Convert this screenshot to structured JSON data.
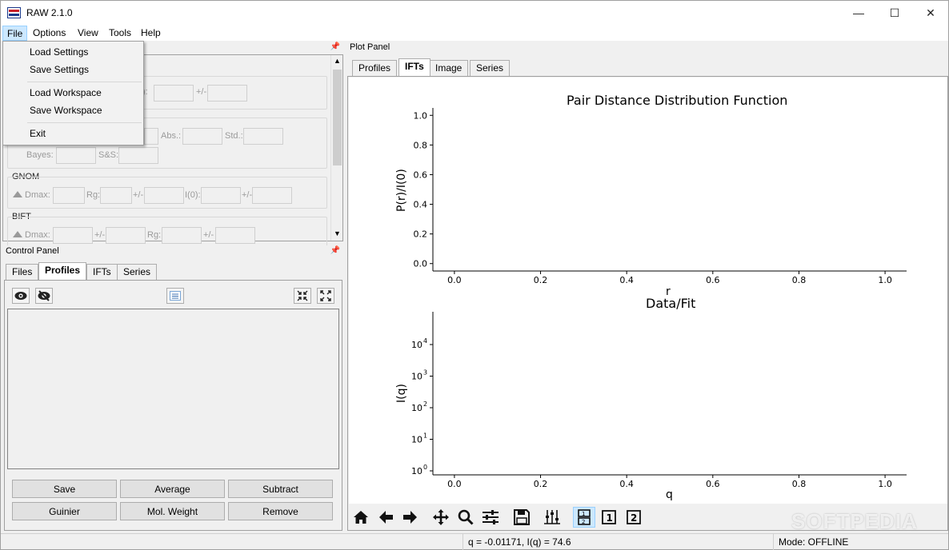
{
  "window": {
    "title": "RAW 2.1.0",
    "controls": {
      "minimize": "—",
      "maximize": "☐",
      "close": "✕"
    }
  },
  "menubar": [
    "File",
    "Options",
    "View",
    "Tools",
    "Help"
  ],
  "file_menu": {
    "items": [
      "Load Settings",
      "Save Settings",
      "Load Workspace",
      "Save Workspace",
      "Exit"
    ]
  },
  "info_panel": {
    "fields_row1": {
      "pm": "+/-"
    },
    "fields_row2": {
      "abs": "Abs.:",
      "std": "Std.:"
    },
    "fields_row3": {
      "bayes": "Bayes:",
      "ss": "S&S:"
    },
    "gnom": {
      "title": "GNOM",
      "dmax": "Dmax:",
      "rg": "Rg:",
      "pm1": "+/-",
      "i0": "I(0):",
      "pm2": "+/-"
    },
    "bift": {
      "title": "BIFT",
      "dmax": "Dmax:",
      "pm1": "+/-",
      "rg": "Rg:",
      "pm2": "+/-"
    }
  },
  "control_panel": {
    "title": "Control Panel",
    "tabs": [
      "Files",
      "Profiles",
      "IFTs",
      "Series"
    ],
    "active_tab": "Profiles",
    "buttons": [
      "Save",
      "Average",
      "Subtract",
      "Guinier",
      "Mol. Weight",
      "Remove"
    ]
  },
  "plot_panel": {
    "title": "Plot Panel",
    "tabs": [
      "Profiles",
      "IFTs",
      "Image",
      "Series"
    ],
    "active_tab": "IFTs"
  },
  "chart_data": [
    {
      "type": "line",
      "title": "Pair Distance Distribution Function",
      "xlabel": "r",
      "ylabel": "P(r)/I(0)",
      "xlim": [
        -0.05,
        1.05
      ],
      "ylim": [
        -0.05,
        1.05
      ],
      "xticks": [
        "0.0",
        "0.2",
        "0.4",
        "0.6",
        "0.8",
        "1.0"
      ],
      "yticks": [
        "0.0",
        "0.2",
        "0.4",
        "0.6",
        "0.8",
        "1.0"
      ],
      "series": []
    },
    {
      "type": "line",
      "title": "Data/Fit",
      "xlabel": "q",
      "ylabel": "I(q)",
      "yscale": "log",
      "xlim": [
        -0.05,
        1.05
      ],
      "ylim": [
        1,
        10000
      ],
      "xticks": [
        "0.0",
        "0.2",
        "0.4",
        "0.6",
        "0.8",
        "1.0"
      ],
      "yticks": [
        {
          "base": "10",
          "exp": "0"
        },
        {
          "base": "10",
          "exp": "1"
        },
        {
          "base": "10",
          "exp": "2"
        },
        {
          "base": "10",
          "exp": "3"
        },
        {
          "base": "10",
          "exp": "4"
        }
      ],
      "series": []
    }
  ],
  "statusbar": {
    "coords": "q = -0.01171, I(q) = 74.6",
    "mode": "Mode: OFFLINE"
  },
  "watermark": "SOFTPEDIA"
}
